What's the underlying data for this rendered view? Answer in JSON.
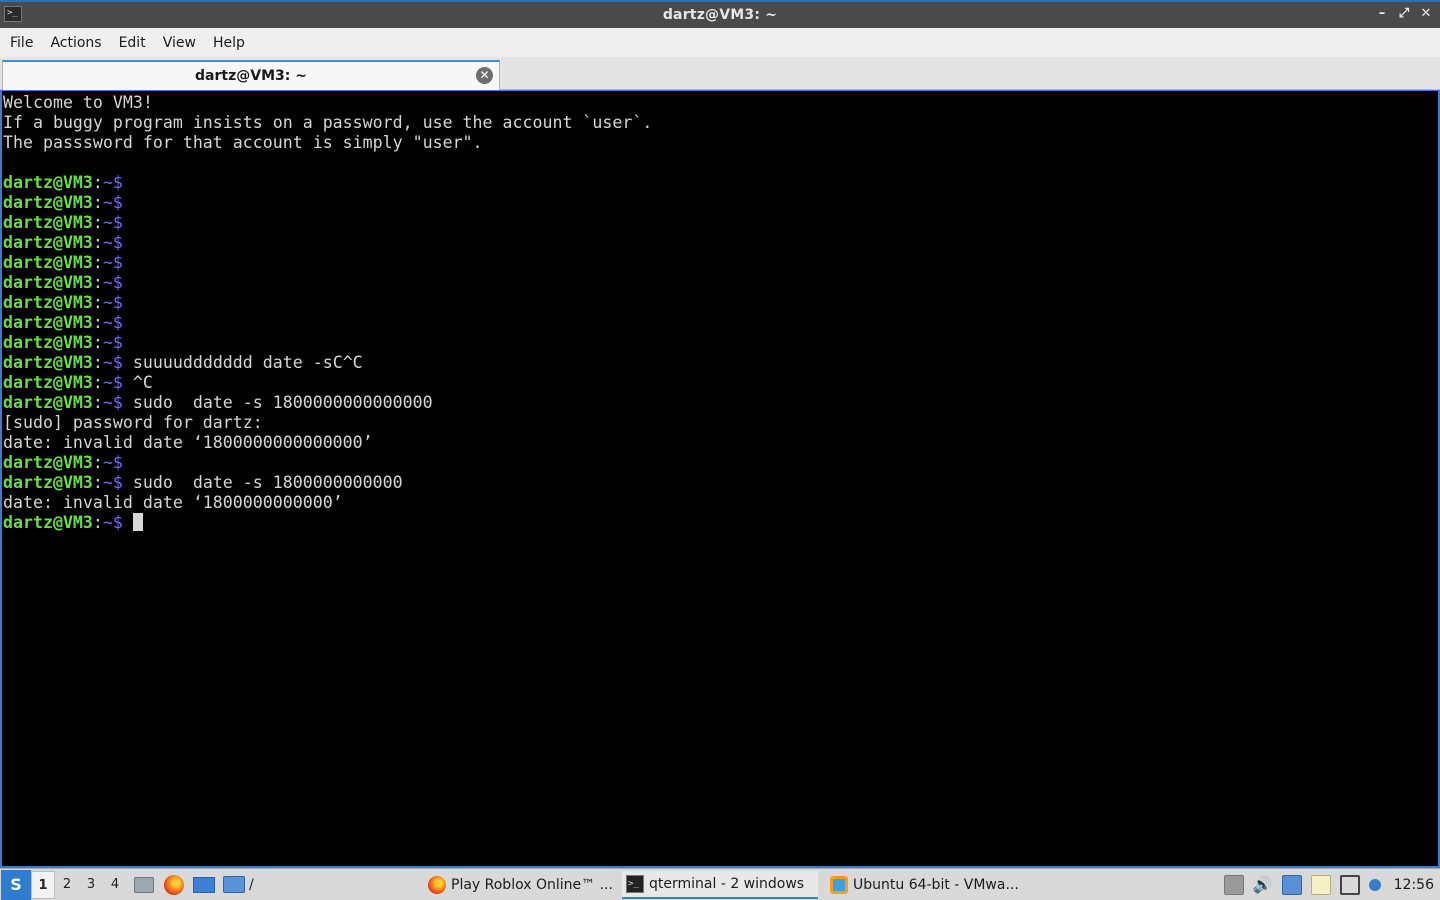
{
  "window": {
    "title": "dartz@VM3: ~",
    "controls": {
      "minimize": "–",
      "maximize": "⤢",
      "close": "✕"
    }
  },
  "menu": [
    "File",
    "Actions",
    "Edit",
    "View",
    "Help"
  ],
  "tab": {
    "label": "dartz@VM3: ~",
    "close_icon": "close-circle-icon"
  },
  "terminal": {
    "prompt_user": "dartz@VM3",
    "prompt_colon": ":",
    "prompt_path": "~$",
    "lines": [
      {
        "type": "text",
        "text": "Welcome to VM3!"
      },
      {
        "type": "text",
        "text": "If a buggy program insists on a password, use the account `user`."
      },
      {
        "type": "text",
        "text": "The passsword for that account is simply \"user\"."
      },
      {
        "type": "text",
        "text": ""
      },
      {
        "type": "prompt",
        "cmd": ""
      },
      {
        "type": "prompt",
        "cmd": ""
      },
      {
        "type": "prompt",
        "cmd": ""
      },
      {
        "type": "prompt",
        "cmd": ""
      },
      {
        "type": "prompt",
        "cmd": ""
      },
      {
        "type": "prompt",
        "cmd": ""
      },
      {
        "type": "prompt",
        "cmd": ""
      },
      {
        "type": "prompt",
        "cmd": ""
      },
      {
        "type": "prompt",
        "cmd": ""
      },
      {
        "type": "prompt",
        "cmd": " suuuuddddddd date -sC^C"
      },
      {
        "type": "prompt",
        "cmd": " ^C"
      },
      {
        "type": "prompt",
        "cmd": " sudo  date -s 1800000000000000"
      },
      {
        "type": "text",
        "text": "[sudo] password for dartz:"
      },
      {
        "type": "text",
        "text": "date: invalid date ‘1800000000000000’"
      },
      {
        "type": "prompt",
        "cmd": ""
      },
      {
        "type": "prompt",
        "cmd": " sudo  date -s 1800000000000"
      },
      {
        "type": "text",
        "text": "date: invalid date ‘1800000000000’"
      },
      {
        "type": "prompt",
        "cmd": " ",
        "cursor": true
      }
    ]
  },
  "taskbar": {
    "start_icon": "lxqt-menu-icon",
    "desktops": [
      "1",
      "2",
      "3",
      "4"
    ],
    "active_desktop": "1",
    "quicklaunch_text": "/",
    "tasks": [
      {
        "label": "Play Roblox Online™ ...",
        "icon": "firefox-icon"
      },
      {
        "label": "qterminal - 2 windows",
        "icon": "terminal-icon"
      },
      {
        "label": "Ubuntu 64-bit - VMwa...",
        "icon": "vmware-icon"
      }
    ],
    "tray_volume_glyph": "🔊",
    "clock": "12:56"
  }
}
